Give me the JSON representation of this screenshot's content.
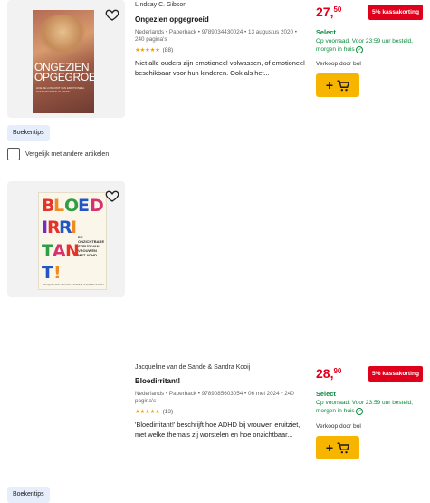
{
  "products": [
    {
      "author": "Lindsay C. Gibson",
      "title": "Ongezien opgegroeid",
      "meta": "Nederlands • Paperback • 9789034430024 • 13 augustus 2020 • 240 pagina's",
      "stars": "★★★★★",
      "review_count": "(88)",
      "description": "Niet alle ouders zijn emotioneel volwassen, of emotioneel beschikbaar voor hun kinderen. Ook als het...",
      "price_main": "27,",
      "price_cents": "50",
      "discount": "5% kassakorting",
      "select": "Select",
      "availability": "Op voorraad. Voor 23:59 uur besteld, morgen in huis",
      "seller": "Verkoop door bol",
      "cart_plus": "+",
      "badge": "Boekentips",
      "cover_title": "ONGEZIEN OPGEGROEID",
      "cover_subtitle": "HOE JE LOSKOMT VAN EMOTIONEEL ONVOLWASSEN OUDERS"
    },
    {
      "author": "Jacqueline van de Sande & Sandra Kooij",
      "title": "Bloedirritant!",
      "meta": "Nederlands • Paperback • 9789085603054 • 06 mei 2024 • 240 pagina's",
      "stars": "★★★★★",
      "review_count": "(13)",
      "description": "'Bloedirritant!' beschrijft hoe ADHD bij vrouwen eruitziet, met welke thema's zij worstelen en hoe onzichtbaar...",
      "price_main": "28,",
      "price_cents": "90",
      "discount": "5% kassakorting",
      "select": "Select",
      "availability": "Op voorraad. Voor 23:59 uur besteld, morgen in huis",
      "seller": "Verkoop door bol",
      "cart_plus": "+",
      "badge": "Boekentips",
      "cover_side": "DE ONZICHTBARE STRIJD VAN VROUWEN MET ADHD",
      "cover_authors": "JACQUELINE VAN DE SANDE & SANDRA KOOIJ"
    }
  ],
  "compare_label": "Vergelijk met andere artikelen",
  "colors": {
    "price": "#e0001b",
    "select": "#0a8a3c",
    "cart": "#f7b500",
    "badge_bg": "#e6eefb"
  }
}
